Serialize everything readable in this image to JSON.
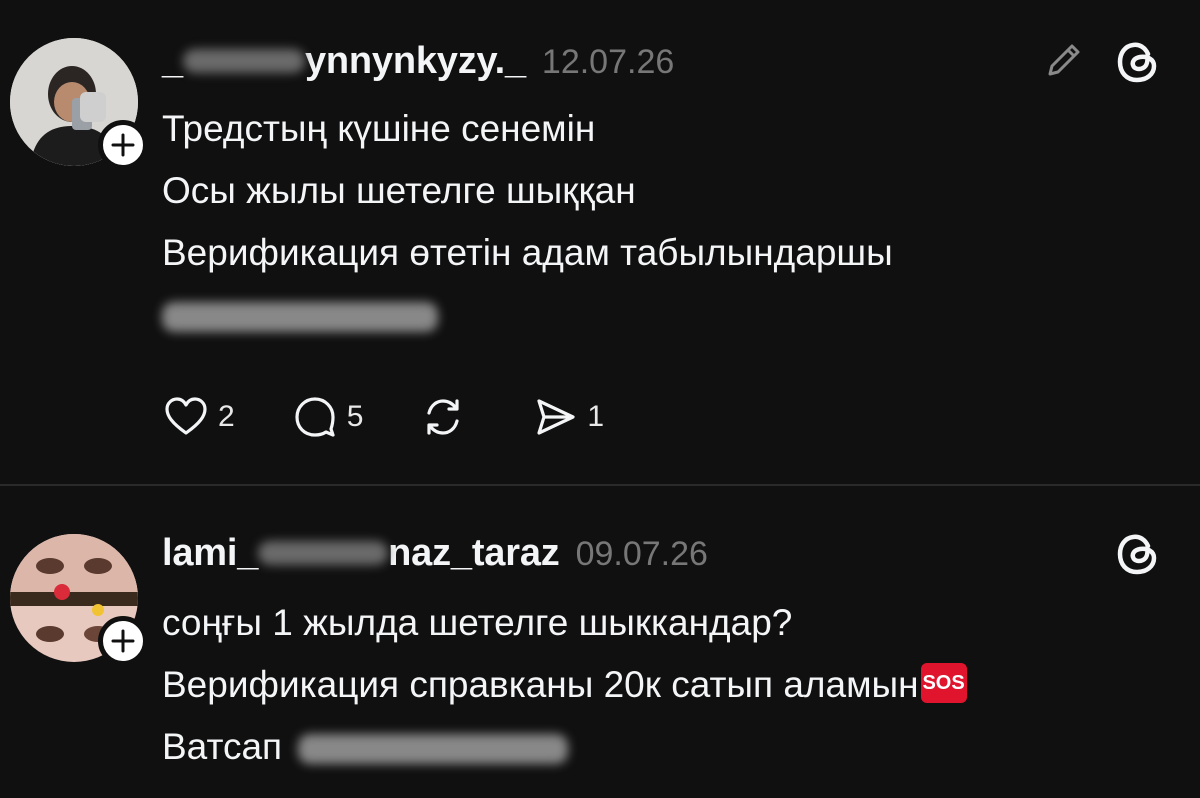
{
  "posts": [
    {
      "username_prefix": "_",
      "username_suffix": "ynnynkyzy._",
      "date": "12.07.26",
      "lines": [
        "Тредстың күшіне сенемін",
        "Осы жылы шетелге шыққан",
        "Верификация өтетін адам табылындаршы"
      ],
      "actions": {
        "likes": "2",
        "replies": "5",
        "reposts": "",
        "shares": "1"
      }
    },
    {
      "username_prefix": "lami_",
      "username_suffix": "naz_taraz",
      "date": "09.07.26",
      "lines": [
        "соңғы 1 жылда шетелге шыккандар?",
        "Верификация справканы  20к сатып аламын",
        "Ватсап"
      ],
      "emoji": "SOS"
    }
  ],
  "colors": {
    "background": "#101010",
    "text": "#f3f5f7",
    "muted": "#777777",
    "sos": "#e0142d"
  },
  "icons": [
    "edit-pencil-icon",
    "threads-logo-icon",
    "heart-icon",
    "comment-icon",
    "repost-icon",
    "share-icon",
    "plus-icon"
  ]
}
